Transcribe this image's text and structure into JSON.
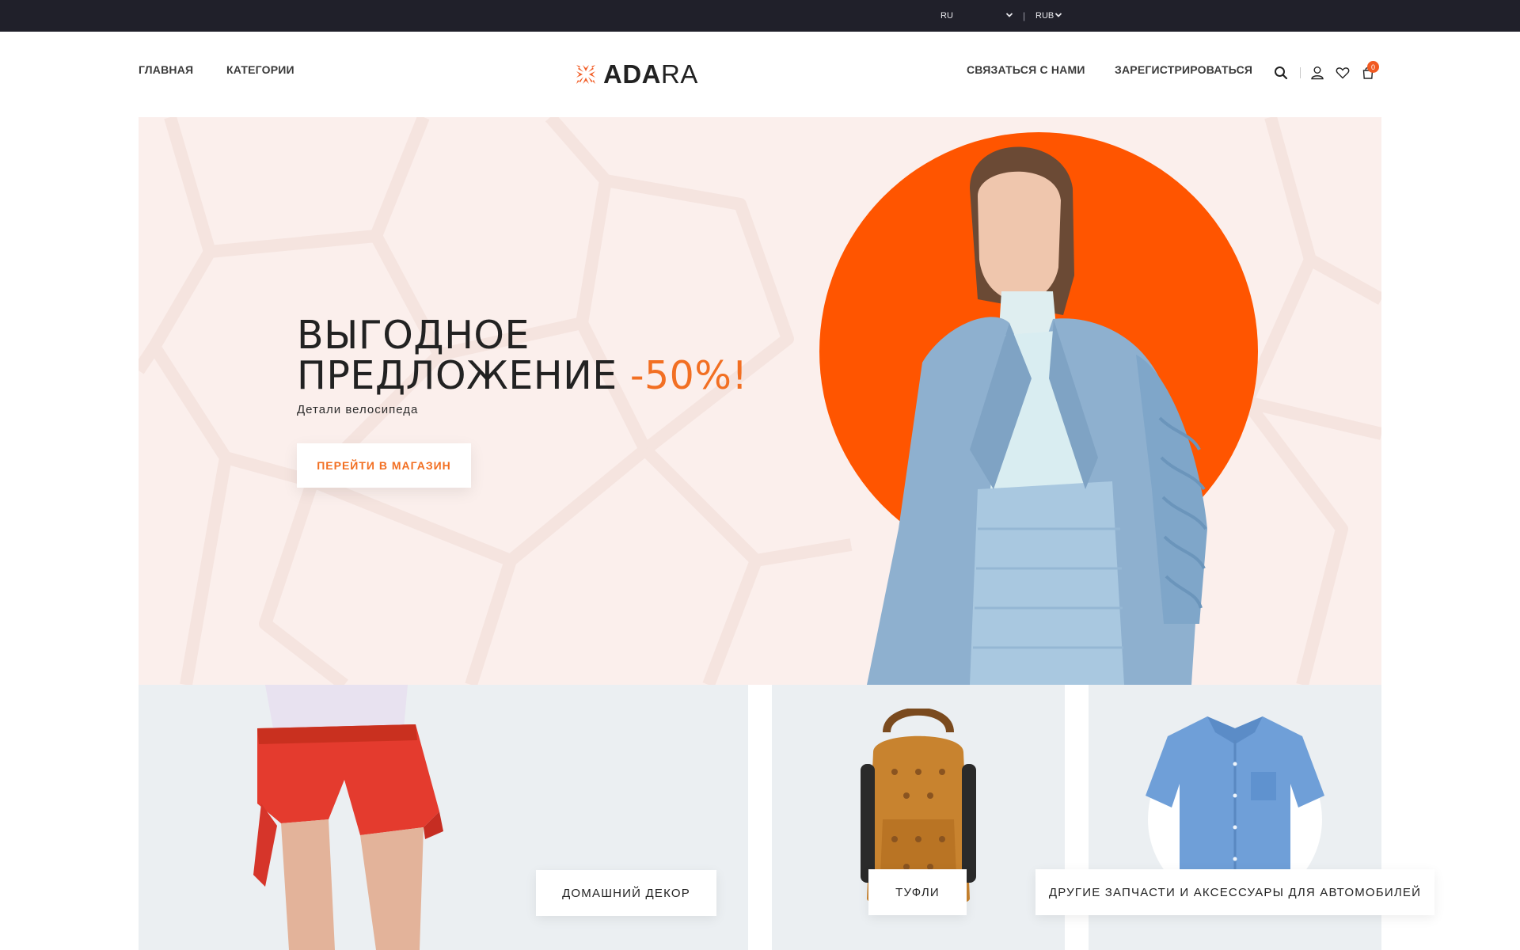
{
  "topbar": {
    "language": "RU",
    "currency": "RUB"
  },
  "nav": {
    "home": "ГЛАВНАЯ",
    "categories": "КАТЕГОРИИ",
    "contact": "СВЯЗАТЬСЯ С НАМИ",
    "register": "ЗАРЕГИСТРИРОВАТЬСЯ"
  },
  "logo": {
    "bold": "ADA",
    "light": "RA"
  },
  "cart": {
    "count": "0"
  },
  "hero": {
    "title_line1": "ВЫГОДНОЕ",
    "title_line2": "ПРЕДЛОЖЕНИЕ",
    "title_accent": "-50%!",
    "subtitle": "Детали велосипеда",
    "button": "ПЕРЕЙТИ В МАГАЗИН"
  },
  "categories": [
    {
      "label": "ДОМАШНИЙ ДЕКОР"
    },
    {
      "label": "ТУФЛИ"
    },
    {
      "label": "ДРУГИЕ ЗАПЧАСТИ И АКСЕССУАРЫ ДЛЯ АВТОМОБИЛЕЙ"
    }
  ],
  "colors": {
    "accent": "#f26f22",
    "hero_circle": "#ff5500",
    "hero_bg": "#fbefec",
    "topbar_bg": "#20202a",
    "tile_bg": "#ebeff2"
  },
  "icons": [
    "chevron-down-icon",
    "logo-mark-icon",
    "search-icon",
    "user-icon",
    "heart-icon",
    "cart-icon"
  ]
}
